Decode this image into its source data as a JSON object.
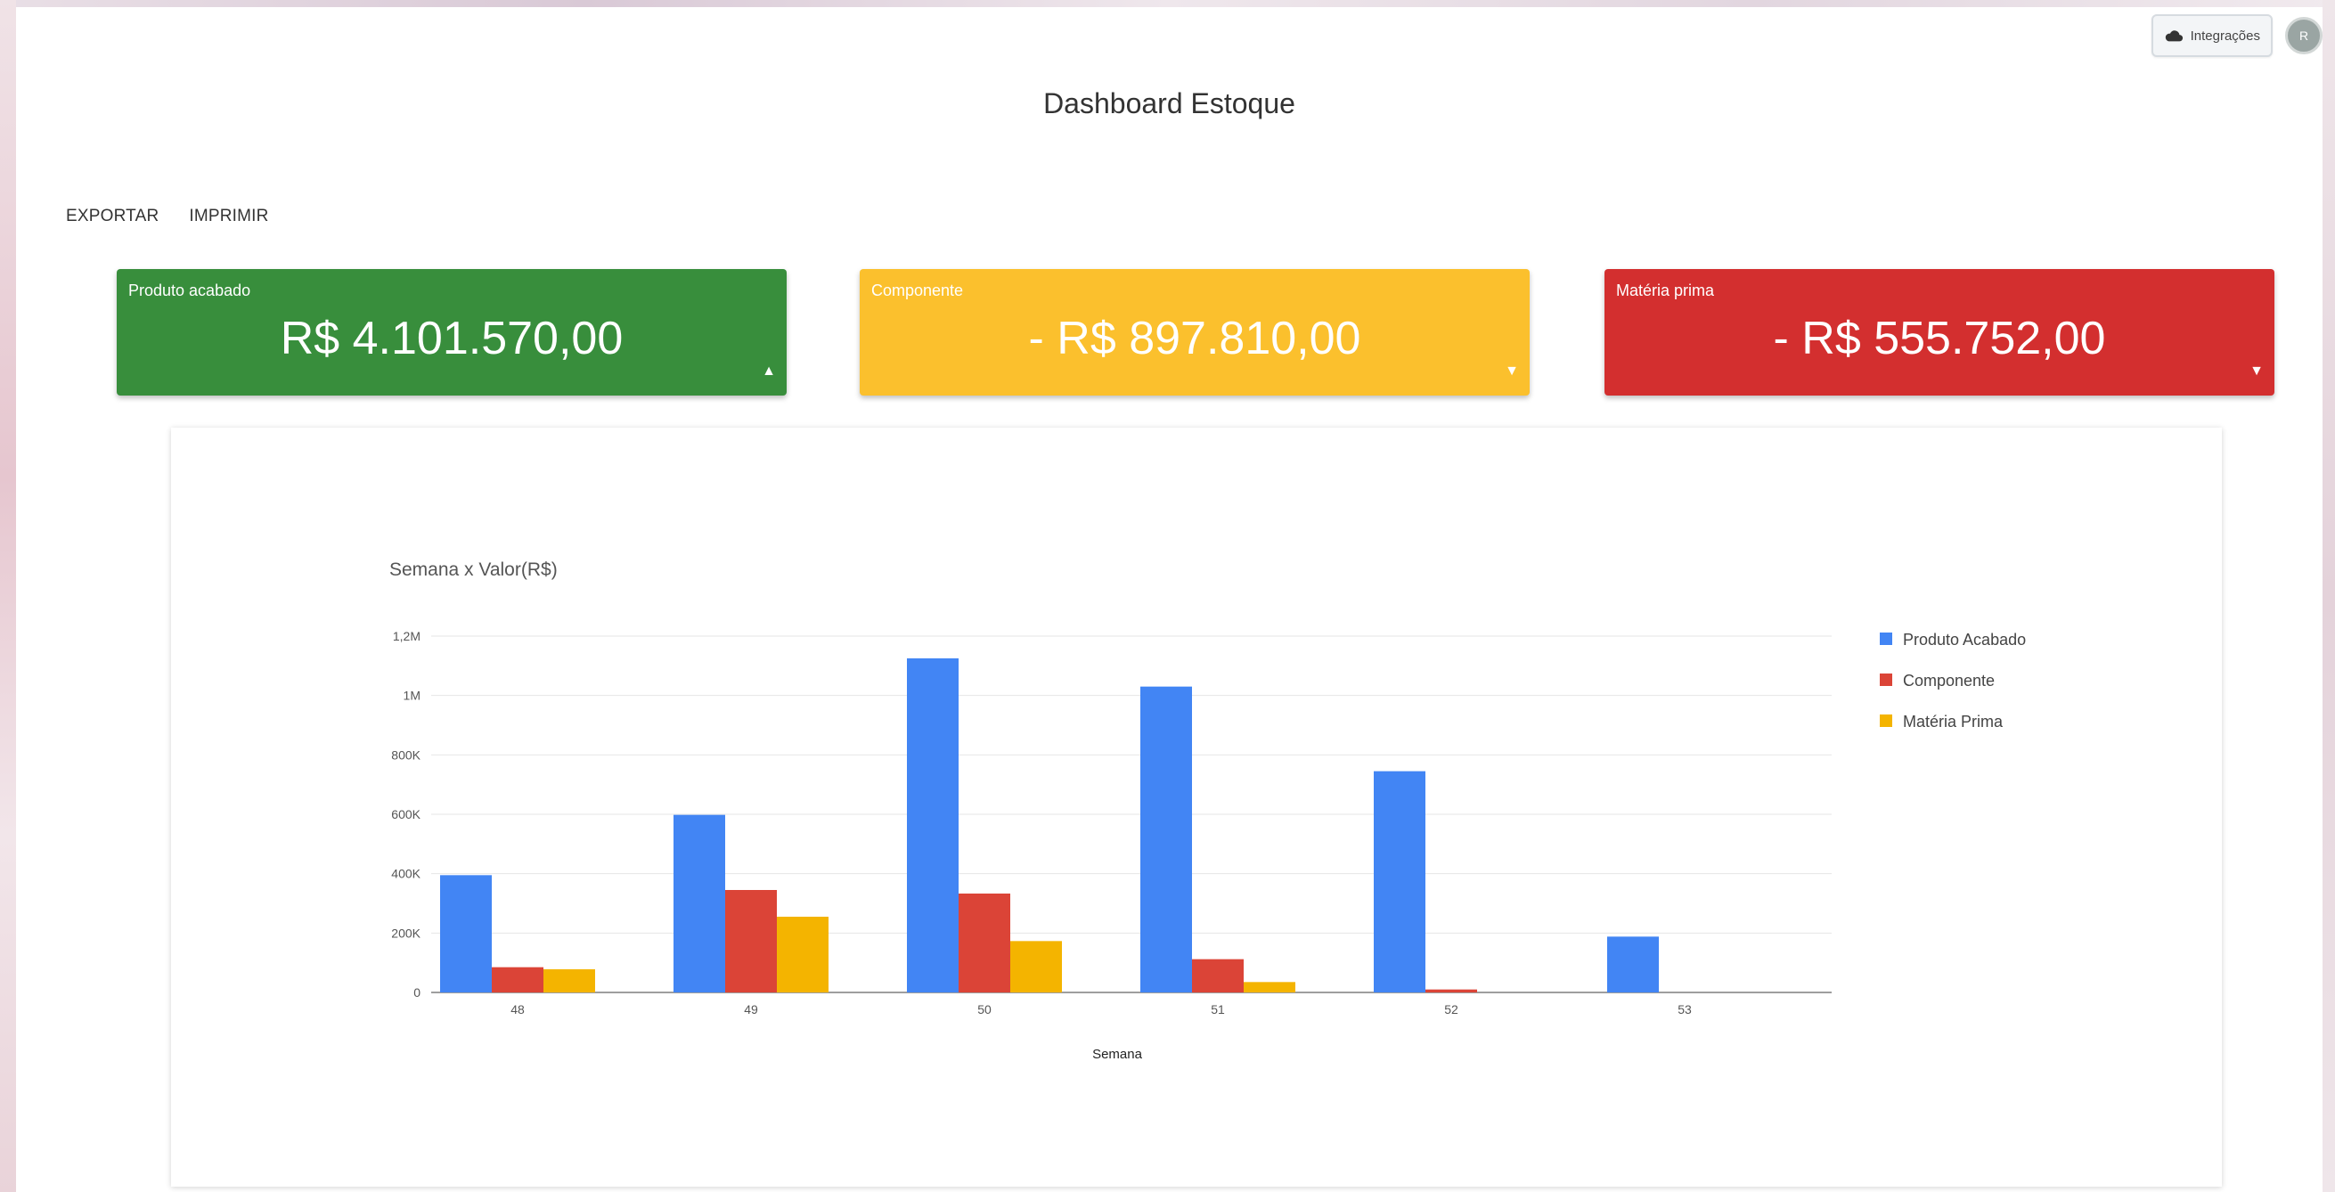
{
  "header": {
    "integrations_label": "Integrações",
    "avatar_text": "R",
    "title": "Dashboard Estoque"
  },
  "actions": {
    "export_label": "EXPORTAR",
    "print_label": "IMPRIMIR"
  },
  "cards": [
    {
      "label": "Produto acabado",
      "value": "R$ 4.101.570,00",
      "color": "#388e3c",
      "trend": "up",
      "arrow": "▲"
    },
    {
      "label": "Componente",
      "value": "- R$ 897.810,00",
      "color": "#fbc02d",
      "trend": "down",
      "arrow": "▼"
    },
    {
      "label": "Matéria prima",
      "value": "- R$ 555.752,00",
      "color": "#d32f2f",
      "trend": "down",
      "arrow": "▼"
    }
  ],
  "chart_data": {
    "type": "bar",
    "title": "Semana x Valor(R$)",
    "xlabel": "Semana",
    "ylabel": "",
    "categories": [
      "48",
      "49",
      "50",
      "51",
      "52",
      "53"
    ],
    "ylim": [
      0,
      1200000
    ],
    "yticks": [
      0,
      200000,
      400000,
      600000,
      800000,
      1000000,
      1200000
    ],
    "ytick_labels": [
      "0",
      "200K",
      "400K",
      "600K",
      "800K",
      "1M",
      "1,2M"
    ],
    "grid": true,
    "legend_position": "right",
    "series": [
      {
        "name": "Produto Acabado",
        "color": "#4285f4",
        "values": [
          395000,
          598000,
          1125000,
          1030000,
          745000,
          188000
        ]
      },
      {
        "name": "Componente",
        "color": "#db4437",
        "values": [
          85000,
          345000,
          333000,
          112000,
          10000,
          0
        ]
      },
      {
        "name": "Matéria Prima",
        "color": "#f4b400",
        "values": [
          78000,
          255000,
          173000,
          35000,
          0,
          0
        ]
      }
    ]
  }
}
